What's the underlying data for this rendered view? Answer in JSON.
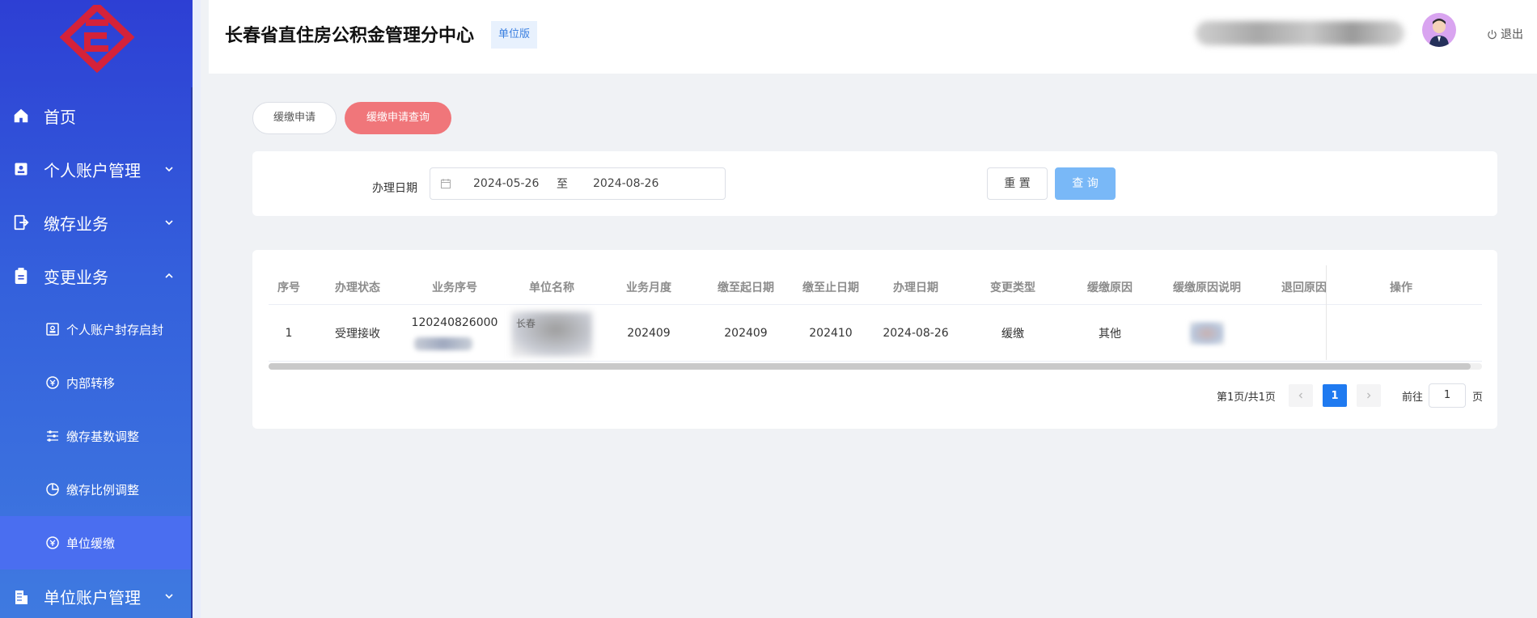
{
  "sidebar": {
    "items": [
      {
        "label": "首页",
        "icon": "home-icon"
      },
      {
        "label": "个人账户管理",
        "icon": "id-card-icon"
      },
      {
        "label": "缴存业务",
        "icon": "deposit-icon"
      },
      {
        "label": "变更业务",
        "icon": "clipboard-icon"
      },
      {
        "label": "单位账户管理",
        "icon": "building-icon"
      }
    ],
    "subitems": [
      {
        "label": "个人账户封存启封",
        "icon": "lock-account-icon"
      },
      {
        "label": "内部转移",
        "icon": "transfer-icon"
      },
      {
        "label": "缴存基数调整",
        "icon": "sliders-icon"
      },
      {
        "label": "缴存比例调整",
        "icon": "pie-icon"
      },
      {
        "label": "单位缓缴",
        "icon": "defer-icon"
      }
    ]
  },
  "header": {
    "title": "长春省直住房公积金管理分中心",
    "badge": "单位版",
    "logout": "退出"
  },
  "tabs": {
    "apply": "缓缴申请",
    "query": "缓缴申请查询"
  },
  "filter": {
    "label": "办理日期",
    "start": "2024-05-26",
    "separator": "至",
    "end": "2024-08-26",
    "reset": "重 置",
    "query": "查 询"
  },
  "table": {
    "headers": [
      "序号",
      "办理状态",
      "业务序号",
      "单位名称",
      "业务月度",
      "缴至起日期",
      "缴至止日期",
      "办理日期",
      "变更类型",
      "缓缴原因",
      "缓缴原因说明",
      "退回原因",
      "操作"
    ],
    "row": {
      "index": "1",
      "status": "受理接收",
      "biz_no": "120240826000",
      "unit": "长春",
      "month": "202409",
      "start": "202409",
      "end": "202410",
      "date": "2024-08-26",
      "change_type": "缓缴",
      "reason": "其他"
    }
  },
  "pagination": {
    "total": "第1页/共1页",
    "current": "1",
    "goto": "前往",
    "input": "1",
    "unit": "页"
  },
  "colors": {
    "accent": "#1f7af0",
    "tab_active": "#f0767a",
    "query_button": "#79b8f7"
  }
}
